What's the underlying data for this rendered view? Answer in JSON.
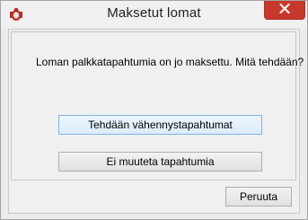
{
  "window": {
    "title": "Maksetut lomat",
    "app_icon": "app-icon",
    "close_icon": "close-icon",
    "close_color": "#c7382c"
  },
  "dialog": {
    "question": "Loman palkkatapahtumia on jo maksettu. Mitä tehdään?",
    "buttons": {
      "create": "Tehdään vähennystapahtumat",
      "no_change": "Ei muuteta tapahtumia",
      "cancel": "Peruuta"
    }
  },
  "colors": {
    "window_bg": "#f0f0f0",
    "focus_border": "#7eb4ea"
  }
}
